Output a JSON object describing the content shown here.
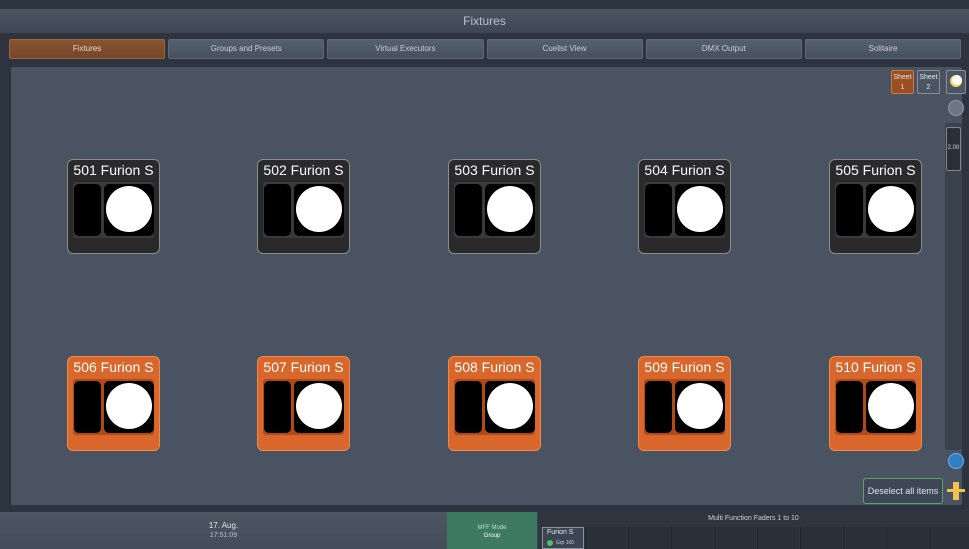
{
  "window": {
    "title": "Fixtures"
  },
  "tabs": [
    {
      "label": "Fixtures",
      "active": true
    },
    {
      "label": "Groups and Presets",
      "active": false
    },
    {
      "label": "Virtual Executors",
      "active": false
    },
    {
      "label": "Cuelist View",
      "active": false
    },
    {
      "label": "DMX Output",
      "active": false
    },
    {
      "label": "Solitaire",
      "active": false
    }
  ],
  "sheets": [
    {
      "label": "Sheet",
      "number": "1",
      "active": true
    },
    {
      "label": "Sheet",
      "number": "2",
      "active": false
    }
  ],
  "fixtures": [
    {
      "label": "501 Furion S",
      "selected": false
    },
    {
      "label": "502 Furion S",
      "selected": false
    },
    {
      "label": "503 Furion S",
      "selected": false
    },
    {
      "label": "504 Furion S",
      "selected": false
    },
    {
      "label": "505 Furion S",
      "selected": false
    },
    {
      "label": "506 Furion S",
      "selected": true
    },
    {
      "label": "507 Furion S",
      "selected": true
    },
    {
      "label": "508 Furion S",
      "selected": true
    },
    {
      "label": "509 Furion S",
      "selected": true
    },
    {
      "label": "510 Furion S",
      "selected": true
    }
  ],
  "zoom": {
    "value": "2.00"
  },
  "deselect_label": "Deselect all items",
  "footer": {
    "date": "17. Aug.",
    "time": "17:51:09",
    "mff_mode_label": "MFF Mode",
    "mff_mode_value": "Group",
    "faders_title": "Multi Function Faders 1 to 10",
    "fader1_name": "Furion S",
    "fader1_group": "Grp 100"
  },
  "colors": {
    "selected": "#d9662a",
    "active_tab": "#8a5530",
    "mff": "#3e7a62"
  }
}
